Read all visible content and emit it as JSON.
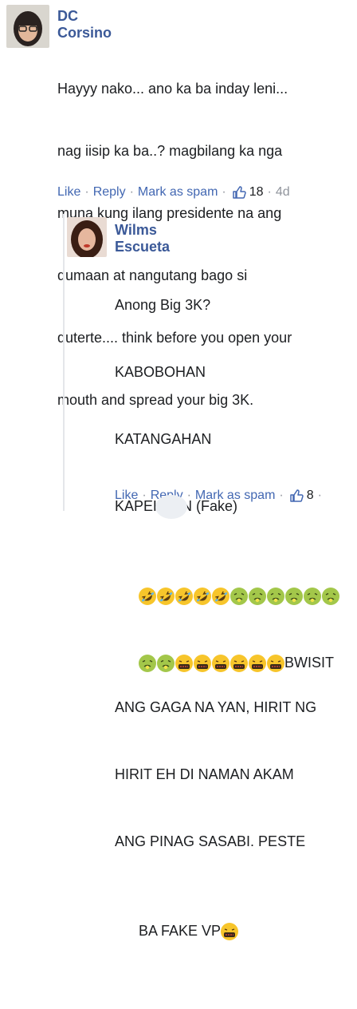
{
  "comment1": {
    "author": "DC Corsino",
    "lines": [
      "Hayyy nako... ano ka ba inday leni...",
      "nag iisip ka ba..? magbilang ka nga",
      "muna kung ilang presidente na ang",
      "dumaan at nangutang bago si",
      "duterte.... think before you open your",
      "mouth and spread your big 3K."
    ],
    "actions": {
      "like": "Like",
      "reply": "Reply",
      "spam": "Mark as spam",
      "reactions": "18",
      "time": "4d"
    }
  },
  "reply1": {
    "author": "Wilms Escueta",
    "lines": [
      "Anong Big 3K?",
      "KABOBOHAN",
      "KATANGAHAN",
      "KAPEKEAN (Fake)"
    ],
    "emoji_line2_text": "BWISIT",
    "lines2": [
      "ANG GAGA NA YAN, HIRIT NG",
      "HIRIT EH DI NAMAN AKAM",
      "ANG PINAG SASABI. PESTE"
    ],
    "last_line": "BA FAKE VP",
    "actions": {
      "like": "Like",
      "reply": "Reply",
      "spam": "Mark as spam",
      "reactions": "8",
      "time": ""
    }
  },
  "icons": {
    "like": "thumbs-up-icon",
    "laugh": "rolling-laughing-emoji",
    "sick": "nauseated-face-emoji",
    "mask": "cursing-face-emoji"
  },
  "colors": {
    "link": "#4267b2",
    "author": "#3b5998",
    "meta": "#90949c"
  }
}
